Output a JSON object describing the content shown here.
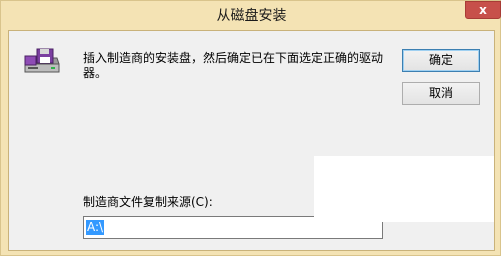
{
  "window": {
    "title": "从磁盘安装",
    "close_glyph": "x"
  },
  "message": "插入制造商的安装盘，然后确定已在下面选定正确的驱动器。",
  "buttons": {
    "ok": "确定",
    "cancel": "取消"
  },
  "source": {
    "label": "制造商文件复制来源(C):",
    "value": "A:\\"
  },
  "icons": {
    "disk": "disk-drive-icon"
  },
  "colors": {
    "title_bar": "#f4e3b4",
    "close_button": "#c7504a",
    "selection": "#3399ff"
  }
}
